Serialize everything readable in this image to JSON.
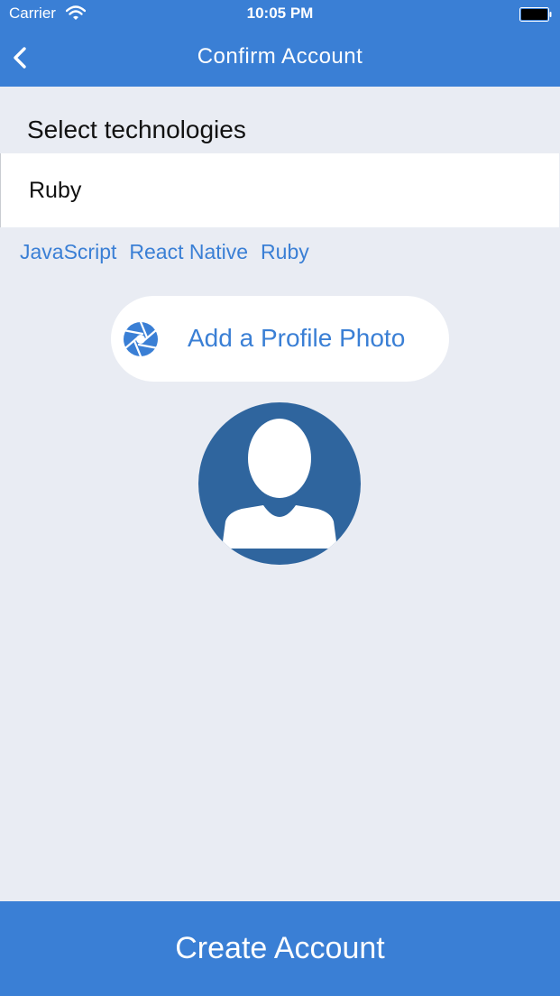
{
  "status_bar": {
    "carrier": "Carrier",
    "time": "10:05 PM",
    "wifi_icon": "wifi-icon",
    "battery_icon": "battery-icon"
  },
  "nav": {
    "back_icon": "chevron-left-icon",
    "title": "Confirm Account"
  },
  "technologies": {
    "label": "Select technologies",
    "input_value": "Ruby",
    "tags": [
      "JavaScript",
      "React Native",
      "Ruby"
    ]
  },
  "profile_photo": {
    "button_label": "Add a Profile Photo",
    "button_icon": "camera-aperture-icon",
    "avatar_icon": "default-avatar-icon"
  },
  "footer": {
    "create_label": "Create Account"
  },
  "colors": {
    "accent": "#3a7fd5",
    "background": "#e9ecf3",
    "avatar": "#2f659e"
  }
}
